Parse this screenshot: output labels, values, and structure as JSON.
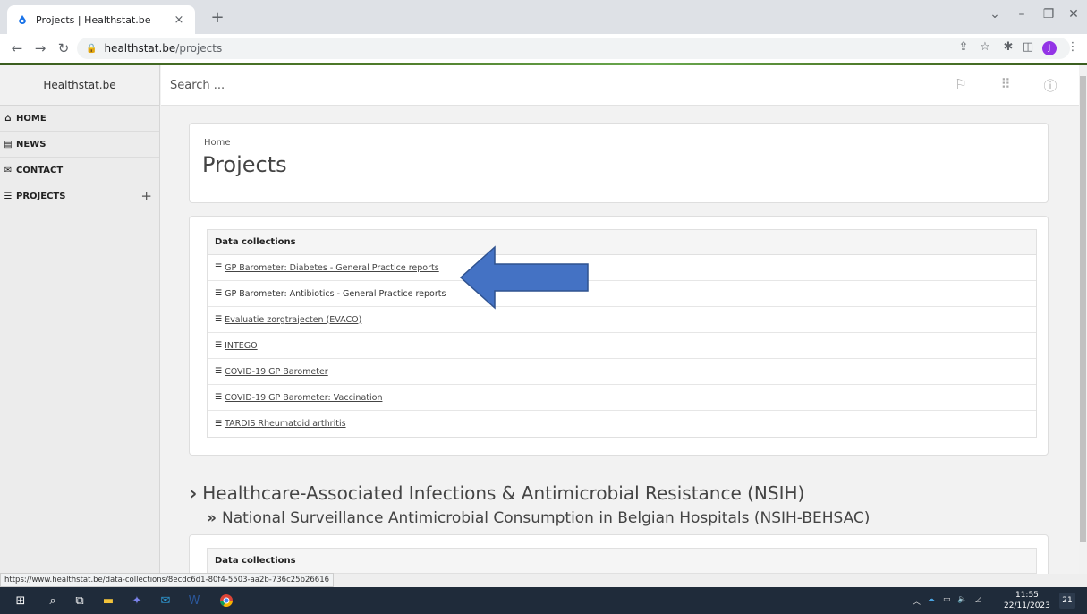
{
  "browser": {
    "tab_title": "Projects | Healthstat.be",
    "tab_close": "×",
    "new_tab": "+",
    "url_host": "healthstat.be",
    "url_path": "/projects",
    "profile_initial": "J"
  },
  "sidebar": {
    "brand": "Healthstat.be",
    "items": [
      {
        "label": "HOME",
        "icon": "home-icon"
      },
      {
        "label": "NEWS",
        "icon": "newspaper-icon"
      },
      {
        "label": "CONTACT",
        "icon": "envelope-icon"
      },
      {
        "label": "PROJECTS",
        "icon": "database-icon"
      }
    ],
    "expand": "+"
  },
  "header": {
    "search_placeholder": "Search ..."
  },
  "main": {
    "breadcrumb": "Home",
    "title": "Projects",
    "data_collections_header": "Data collections",
    "collections": [
      {
        "label": "GP Barometer: Diabetes - General Practice reports",
        "link": true
      },
      {
        "label": "GP Barometer: Antibiotics - General Practice reports",
        "link": false
      },
      {
        "label": "Evaluatie zorgtrajecten (EVACO)",
        "link": true
      },
      {
        "label": "INTEGO",
        "link": true
      },
      {
        "label": "COVID-19 GP Barometer",
        "link": true
      },
      {
        "label": "COVID-19 GP Barometer: Vaccination",
        "link": true
      },
      {
        "label": "TARDIS Rheumatoid arthritis",
        "link": true
      }
    ],
    "section_h1": "Healthcare-Associated Infections & Antimicrobial Resistance (NSIH)",
    "section_h2": "National Surveillance Antimicrobial Consumption in Belgian Hospitals (NSIH-BEHSAC)",
    "data_collections_header_2": "Data collections"
  },
  "status_url": "https://www.healthstat.be/data-collections/8ecdc6d1-80f4-5503-aa2b-736c25b26616",
  "taskbar": {
    "time": "11:55",
    "date": "22/11/2023",
    "notifications": "21"
  },
  "colors": {
    "arrow": "#4472c4",
    "arrow_border": "#2f528f",
    "header_green": "#4f7b2a"
  }
}
